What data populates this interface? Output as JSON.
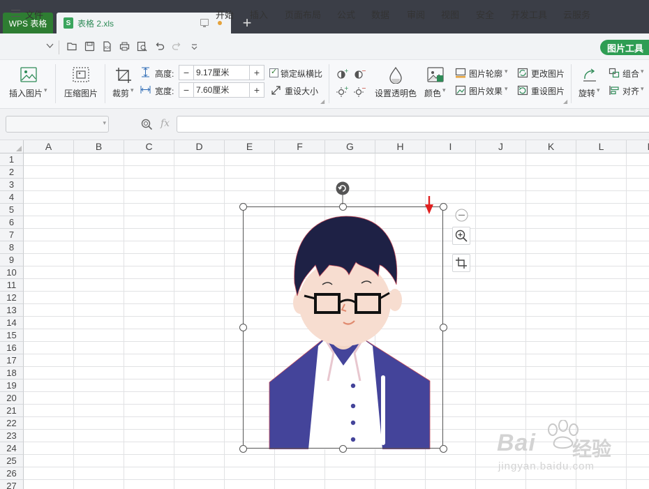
{
  "titlebar": {
    "app_tab": "WPS 表格",
    "doc_tab": "表格 2.xls",
    "doc_icon_letter": "S",
    "new_tab": "+"
  },
  "menubar": {
    "file": "文件",
    "items": [
      "开始",
      "插入",
      "页面布局",
      "公式",
      "数据",
      "审阅",
      "视图",
      "安全",
      "开发工具",
      "云服务"
    ],
    "active": "图片工具"
  },
  "ribbon": {
    "insert_picture": "插入图片",
    "compress_picture": "压缩图片",
    "crop": "裁剪",
    "height_label": "高度:",
    "height_value": "9.17厘米",
    "width_label": "宽度:",
    "width_value": "7.60厘米",
    "lock_ratio": "锁定纵横比",
    "reset_size": "重设大小",
    "set_transparent": "设置透明色",
    "color": "颜色",
    "picture_outline": "图片轮廓",
    "picture_effect": "图片效果",
    "change_picture": "更改图片",
    "reset_picture": "重设图片",
    "rotate": "旋转",
    "group": "组合",
    "align": "对齐",
    "minus": "−",
    "plus": "+"
  },
  "formula_bar": {
    "fx": "fx",
    "name_box": "",
    "content": ""
  },
  "sheet": {
    "columns": [
      "A",
      "B",
      "C",
      "D",
      "E",
      "F",
      "G",
      "H",
      "I",
      "J",
      "K",
      "L",
      "M"
    ],
    "rows": [
      "1",
      "2",
      "3",
      "4",
      "5",
      "6",
      "7",
      "8",
      "9",
      "10",
      "11",
      "12",
      "13",
      "14",
      "15",
      "16",
      "17",
      "18",
      "19",
      "20",
      "21",
      "22",
      "23",
      "24",
      "25",
      "26",
      "27"
    ]
  },
  "watermark": {
    "brand": "Bai",
    "brand_cn": "经验",
    "url": "jingyan.baidu.com"
  },
  "colors": {
    "titlebar_bg": "#3b3e47",
    "accent_green": "#2e9d53",
    "jacket": "#44449a",
    "hair": "#1e2145",
    "skin": "#f7ddd0",
    "arrow_red": "#e02020"
  }
}
